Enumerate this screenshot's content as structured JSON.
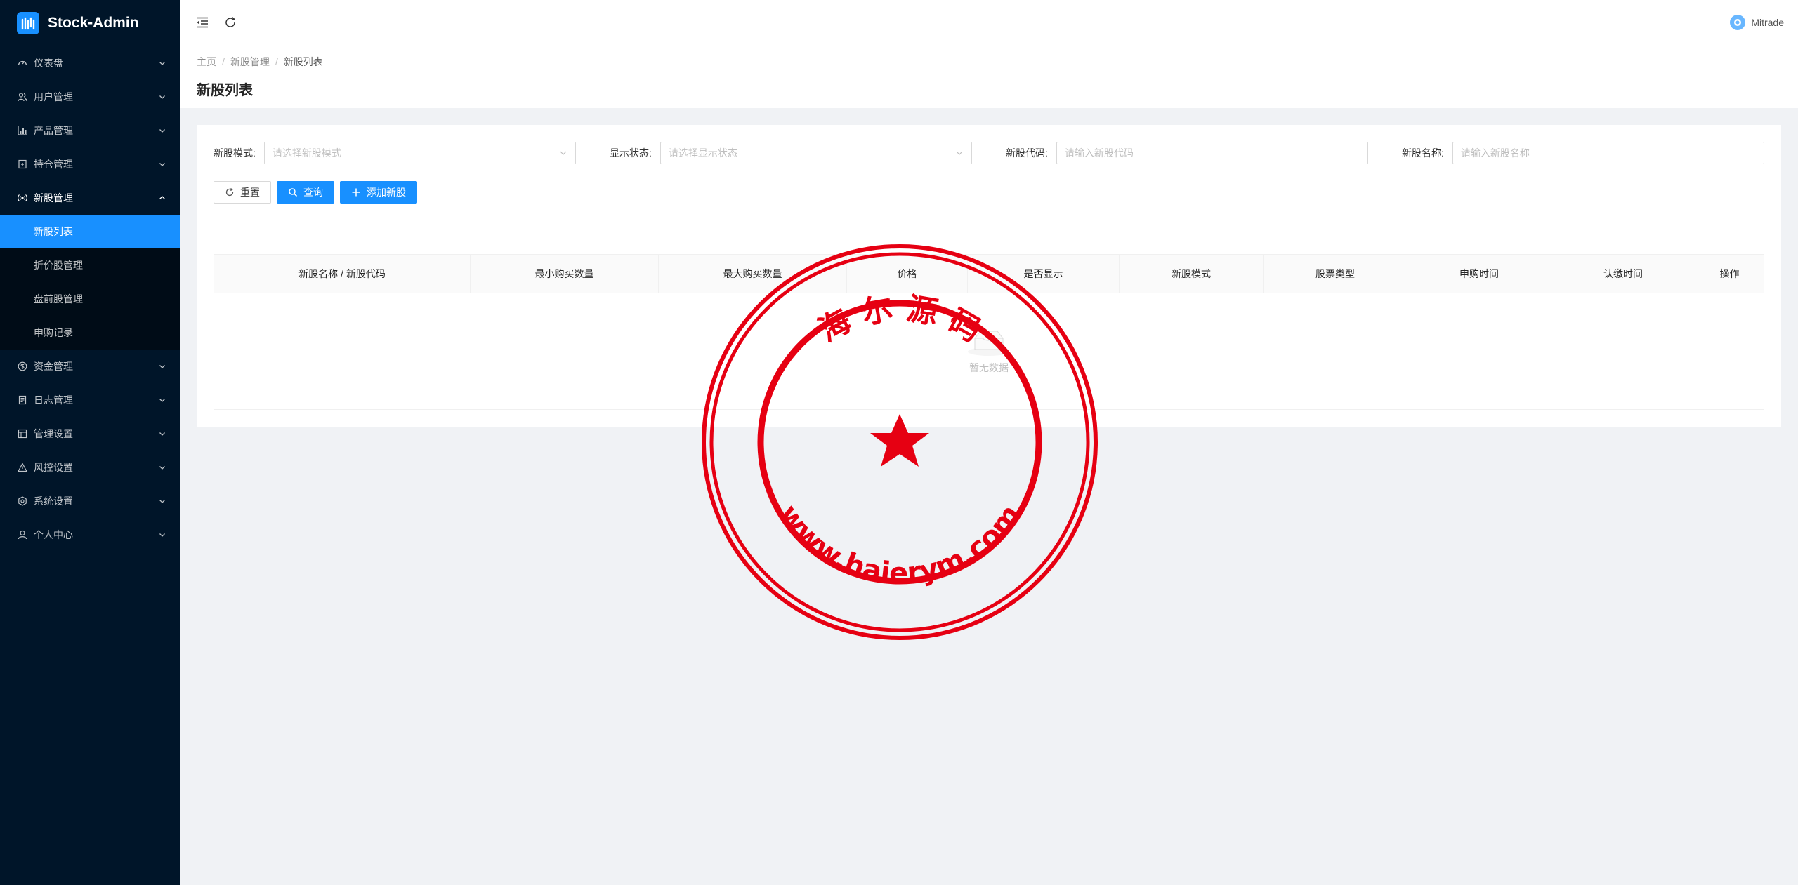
{
  "app": {
    "title": "Stock-Admin"
  },
  "sidebar": {
    "items": [
      {
        "label": "仪表盘",
        "icon": "dashboard-icon"
      },
      {
        "label": "用户管理",
        "icon": "user-group-icon"
      },
      {
        "label": "产品管理",
        "icon": "bar-chart-icon"
      },
      {
        "label": "持仓管理",
        "icon": "wallet-icon"
      },
      {
        "label": "新股管理",
        "icon": "radio-icon",
        "open": true,
        "children": [
          {
            "label": "新股列表",
            "active": true
          },
          {
            "label": "折价股管理"
          },
          {
            "label": "盘前股管理"
          },
          {
            "label": "申购记录"
          }
        ]
      },
      {
        "label": "资金管理",
        "icon": "dollar-circle-icon"
      },
      {
        "label": "日志管理",
        "icon": "log-icon"
      },
      {
        "label": "管理设置",
        "icon": "settings-box-icon"
      },
      {
        "label": "风控设置",
        "icon": "warning-icon"
      },
      {
        "label": "系统设置",
        "icon": "gear-icon"
      },
      {
        "label": "个人中心",
        "icon": "user-icon"
      }
    ]
  },
  "header": {
    "user_name": "Mitrade"
  },
  "breadcrumb": [
    "主页",
    "新股管理",
    "新股列表"
  ],
  "page_title": "新股列表",
  "filters": [
    {
      "label": "新股模式:",
      "placeholder": "请选择新股模式",
      "type": "select"
    },
    {
      "label": "显示状态:",
      "placeholder": "请选择显示状态",
      "type": "select"
    },
    {
      "label": "新股代码:",
      "placeholder": "请输入新股代码",
      "type": "input"
    },
    {
      "label": "新股名称:",
      "placeholder": "请输入新股名称",
      "type": "input"
    }
  ],
  "buttons": {
    "reset": "重置",
    "query": "查询",
    "add": "添加新股"
  },
  "table": {
    "columns": [
      "新股名称 / 新股代码",
      "最小购买数量",
      "最大购买数量",
      "价格",
      "是否显示",
      "新股模式",
      "股票类型",
      "申购时间",
      "认缴时间",
      "操作"
    ],
    "empty_text": "暂无数据"
  },
  "watermark": {
    "top_text": "海 尔 源 码",
    "bottom_text": "www.haierym.com",
    "color": "#e60012"
  },
  "colors": {
    "sidebar_bg": "#001529",
    "primary": "#1890ff",
    "page_bg": "#f0f2f5"
  }
}
